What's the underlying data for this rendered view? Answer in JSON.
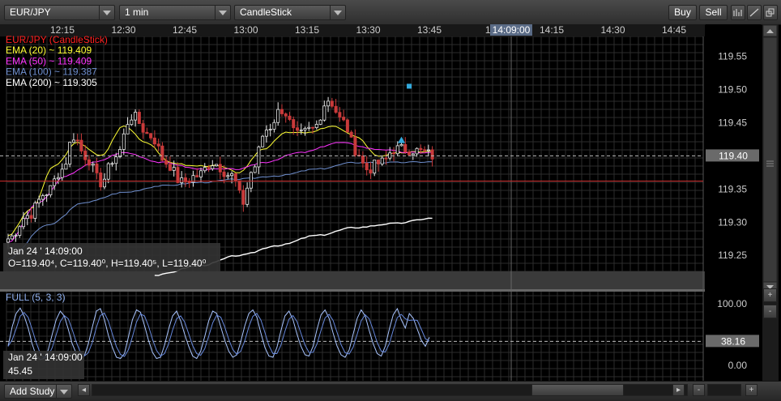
{
  "toolbar": {
    "symbol": "EUR/JPY",
    "interval": "1 min",
    "chart_type": "CandleStick",
    "buy_label": "Buy",
    "sell_label": "Sell",
    "icons": [
      "indicator-icon",
      "draw-line-icon",
      "restore-window-icon"
    ]
  },
  "bottombar": {
    "add_study_label": "Add Study",
    "zoom_out": "-",
    "zoom_in": "+",
    "scroll_left": "◂",
    "scroll_right": "▸"
  },
  "colors": {
    "background": "#000000",
    "grid": "#2c2c2c",
    "candle_up": "#e8e8e8",
    "candle_down": "#c93a3a",
    "ema20": "#ffff33",
    "ema50": "#ff33ff",
    "ema100": "#6f8fcf",
    "ema200": "#ffffff",
    "title": "#ff2020",
    "stoch_k": "#a8c4ff",
    "stoch_d": "#6688dd"
  },
  "chart_data": {
    "type": "candlestick",
    "title": "EUR/JPY (CandleStick)",
    "x_labels": [
      "12:15",
      "12:30",
      "12:45",
      "13:00",
      "13:15",
      "13:30",
      "13:45",
      "14",
      "14:15",
      "14:30",
      "14:45"
    ],
    "cursor_time_label": "14:09:00",
    "ylim": [
      119.21,
      119.58
    ],
    "y_ticks": [
      119.55,
      119.5,
      119.45,
      119.4,
      119.35,
      119.3,
      119.25
    ],
    "last_price": "119.40",
    "last_price_value": 119.4,
    "horizontal_line_value": 119.362,
    "legend": [
      {
        "label": "EUR/JPY (CandleStick)",
        "color": "#ff2020"
      },
      {
        "label": "EMA (20) ~ 119.409",
        "color": "#ffff33"
      },
      {
        "label": "EMA (50) ~ 119.409",
        "color": "#ff33ff"
      },
      {
        "label": "EMA (100) ~ 119.387",
        "color": "#6f8fcf"
      },
      {
        "label": "EMA (200) ~ 119.305",
        "color": "#ffffff"
      }
    ],
    "info_box": {
      "date": "Jan 24 ' 14:09:00",
      "ohlc": "O=119.40⁴, C=119.40⁰, H=119.40⁵, L=119.40⁰"
    },
    "candle_anchors": [
      [
        0,
        119.275
      ],
      [
        5,
        119.31
      ],
      [
        10,
        119.345
      ],
      [
        14,
        119.38
      ],
      [
        17,
        119.43
      ],
      [
        20,
        119.4
      ],
      [
        24,
        119.36
      ],
      [
        28,
        119.4
      ],
      [
        32,
        119.46
      ],
      [
        37,
        119.43
      ],
      [
        41,
        119.39
      ],
      [
        45,
        119.36
      ],
      [
        49,
        119.37
      ],
      [
        53,
        119.39
      ],
      [
        58,
        119.37
      ],
      [
        61,
        119.33
      ],
      [
        63,
        119.375
      ],
      [
        67,
        119.44
      ],
      [
        71,
        119.47
      ],
      [
        75,
        119.43
      ],
      [
        79,
        119.44
      ],
      [
        83,
        119.485
      ],
      [
        87,
        119.45
      ],
      [
        90,
        119.41
      ],
      [
        93,
        119.38
      ],
      [
        97,
        119.39
      ],
      [
        100,
        119.41
      ],
      [
        104,
        119.41
      ],
      [
        108,
        119.405
      ],
      [
        110,
        119.4
      ]
    ],
    "candle_count": 111,
    "candle_seed": 7,
    "markers": [
      {
        "type": "triangle-up",
        "index": 102,
        "value": 119.423,
        "color": "#33aadd"
      },
      {
        "type": "square",
        "index": 104,
        "value": 119.505,
        "color": "#33aadd"
      }
    ],
    "ema_anchors": {
      "ema20": [
        [
          0,
          119.28
        ],
        [
          6,
          119.32
        ],
        [
          12,
          119.385
        ],
        [
          18,
          119.42
        ],
        [
          24,
          119.4
        ],
        [
          30,
          119.445
        ],
        [
          36,
          119.42
        ],
        [
          42,
          119.39
        ],
        [
          48,
          119.385
        ],
        [
          54,
          119.385
        ],
        [
          60,
          119.375
        ],
        [
          66,
          119.41
        ],
        [
          72,
          119.435
        ],
        [
          78,
          119.435
        ],
        [
          84,
          119.445
        ],
        [
          90,
          119.43
        ],
        [
          96,
          119.4
        ],
        [
          102,
          119.405
        ],
        [
          110,
          119.407
        ]
      ],
      "ema50": [
        [
          0,
          119.27
        ],
        [
          8,
          119.33
        ],
        [
          15,
          119.37
        ],
        [
          22,
          119.39
        ],
        [
          30,
          119.405
        ],
        [
          40,
          119.39
        ],
        [
          50,
          119.38
        ],
        [
          60,
          119.38
        ],
        [
          66,
          119.39
        ],
        [
          76,
          119.405
        ],
        [
          86,
          119.42
        ],
        [
          96,
          119.41
        ],
        [
          104,
          119.405
        ],
        [
          110,
          119.405
        ]
      ],
      "ema100": [
        [
          0,
          119.245
        ],
        [
          10,
          119.295
        ],
        [
          20,
          119.33
        ],
        [
          30,
          119.345
        ],
        [
          40,
          119.355
        ],
        [
          50,
          119.36
        ],
        [
          60,
          119.365
        ],
        [
          70,
          119.37
        ],
        [
          80,
          119.38
        ],
        [
          90,
          119.39
        ],
        [
          100,
          119.39
        ],
        [
          110,
          119.391
        ]
      ],
      "ema200": [
        [
          38,
          119.22
        ],
        [
          50,
          119.235
        ],
        [
          60,
          119.25
        ],
        [
          70,
          119.265
        ],
        [
          80,
          119.28
        ],
        [
          90,
          119.292
        ],
        [
          100,
          119.298
        ],
        [
          110,
          119.306
        ]
      ]
    },
    "stochastic": {
      "title": "FULL (5, 3, 3)",
      "ylim": [
        0,
        100
      ],
      "y_ticks_labeled": [
        "100.00",
        "0.00"
      ],
      "last_value": "38.16",
      "last_value_num": 38.16,
      "info_box": {
        "date": "Jan 24 ' 14:09:00",
        "value": "45.45"
      },
      "k_values": [
        30,
        62,
        84,
        93,
        80,
        60,
        34,
        14,
        8,
        10,
        24,
        50,
        74,
        88,
        80,
        58,
        34,
        18,
        10,
        14,
        34,
        62,
        88,
        92,
        74,
        48,
        28,
        12,
        10,
        18,
        46,
        74,
        90,
        86,
        64,
        40,
        20,
        10,
        12,
        32,
        58,
        80,
        88,
        72,
        50,
        30,
        14,
        10,
        22,
        46,
        72,
        88,
        84,
        62,
        40,
        22,
        12,
        16,
        38,
        64,
        84,
        90,
        78,
        52,
        28,
        14,
        12,
        28,
        56,
        80,
        88,
        74,
        50,
        30,
        16,
        14,
        30,
        58,
        82,
        90,
        76,
        52,
        30,
        16,
        12,
        24,
        50,
        76,
        90,
        80,
        56,
        34,
        18,
        14,
        30,
        58,
        82,
        92,
        74,
        60,
        84,
        76,
        58,
        40,
        30,
        45
      ]
    }
  }
}
